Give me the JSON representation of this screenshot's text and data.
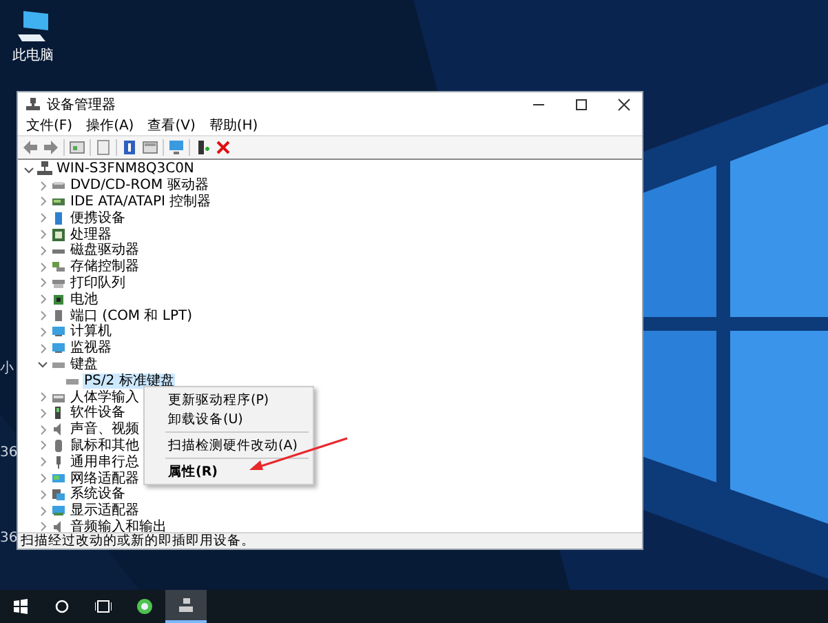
{
  "desktop": {
    "icon_label": "此电脑",
    "partial_labels": [
      "小",
      "36",
      "36"
    ]
  },
  "window": {
    "title": "设备管理器",
    "menu": [
      "文件(F)",
      "操作(A)",
      "查看(V)",
      "帮助(H)"
    ],
    "tree": {
      "label": "WIN-S3FNM8Q3C0N",
      "expanded": true,
      "selected": false,
      "children": [
        {
          "label": "DVD/CD-ROM 驱动器",
          "expanded": false,
          "selected": false
        },
        {
          "label": "IDE ATA/ATAPI 控制器",
          "expanded": false,
          "selected": false
        },
        {
          "label": "便携设备",
          "expanded": false,
          "selected": false
        },
        {
          "label": "处理器",
          "expanded": false,
          "selected": false
        },
        {
          "label": "磁盘驱动器",
          "expanded": false,
          "selected": false
        },
        {
          "label": "存储控制器",
          "expanded": false,
          "selected": false
        },
        {
          "label": "打印队列",
          "expanded": false,
          "selected": false
        },
        {
          "label": "电池",
          "expanded": false,
          "selected": false
        },
        {
          "label": "端口 (COM 和 LPT)",
          "expanded": false,
          "selected": false
        },
        {
          "label": "计算机",
          "expanded": false,
          "selected": false
        },
        {
          "label": "监视器",
          "expanded": false,
          "selected": false
        },
        {
          "label": "键盘",
          "expanded": true,
          "selected": false,
          "children": [
            {
              "label": "PS/2 标准键盘",
              "selected": true
            }
          ]
        },
        {
          "label": "人体学输入",
          "expanded": false,
          "selected": false
        },
        {
          "label": "软件设备",
          "expanded": false,
          "selected": false
        },
        {
          "label": "声音、视频",
          "expanded": false,
          "selected": false
        },
        {
          "label": "鼠标和其他",
          "expanded": false,
          "selected": false
        },
        {
          "label": "通用串行总",
          "expanded": false,
          "selected": false
        },
        {
          "label": "网络适配器",
          "expanded": false,
          "selected": false
        },
        {
          "label": "系统设备",
          "expanded": false,
          "selected": false
        },
        {
          "label": "显示适配器",
          "expanded": false,
          "selected": false
        },
        {
          "label": "音频输入和输出",
          "expanded": false,
          "selected": false
        }
      ]
    },
    "status_bar": "扫描经过改动的或新的即插即用设备。"
  },
  "context_menu": {
    "items": [
      {
        "kind": "item",
        "label": "更新驱动程序(P)",
        "default": false
      },
      {
        "kind": "item",
        "label": "卸载设备(U)",
        "default": false
      },
      {
        "kind": "separator"
      },
      {
        "kind": "item",
        "label": "扫描检测硬件改动(A)",
        "default": false
      },
      {
        "kind": "separator"
      },
      {
        "kind": "item",
        "label": "属性(R)",
        "default": true
      }
    ]
  },
  "taskbar": {
    "buttons": [
      {
        "kind": "start",
        "active": false
      },
      {
        "kind": "search",
        "active": false
      },
      {
        "kind": "task-view",
        "active": false
      },
      {
        "kind": "app",
        "active": false
      },
      {
        "kind": "device-manager",
        "active": true
      }
    ]
  }
}
